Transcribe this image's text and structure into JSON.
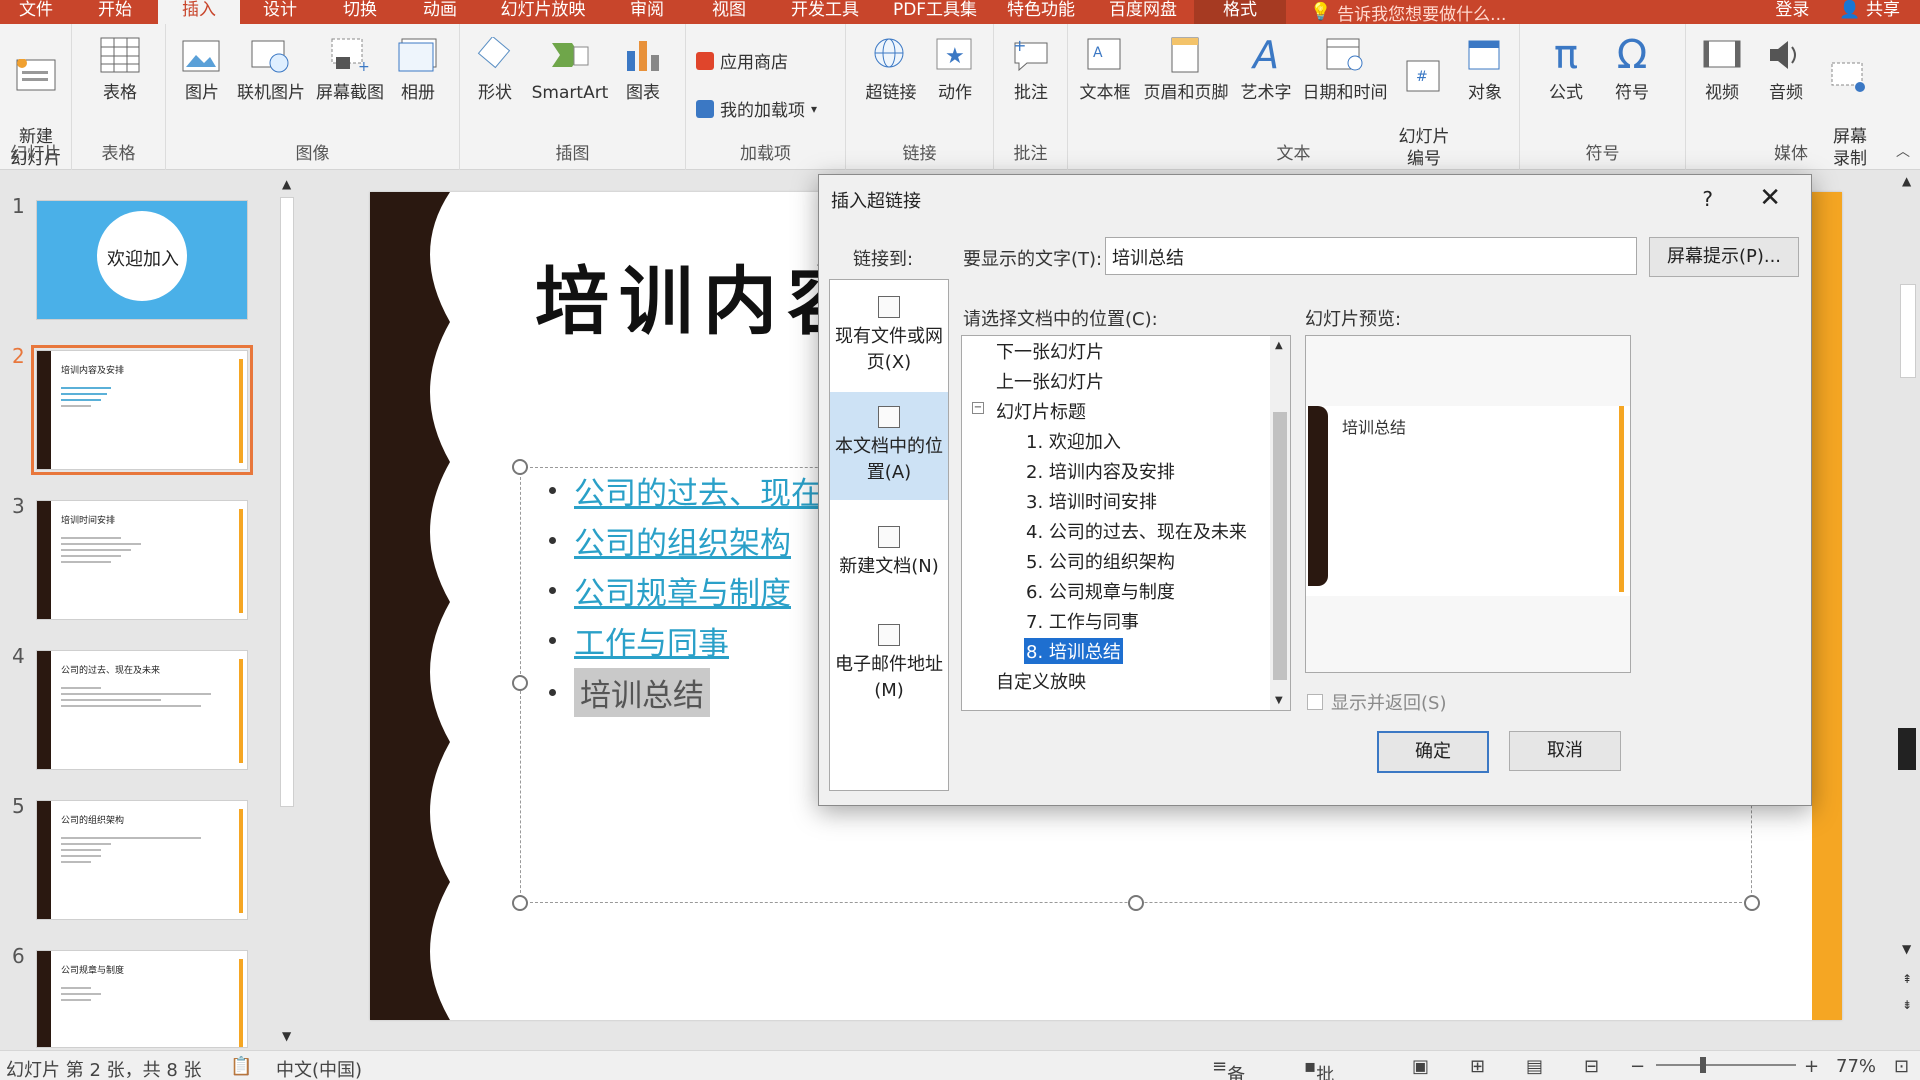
{
  "tabs": [
    "文件",
    "开始",
    "插入",
    "设计",
    "切换",
    "动画",
    "幻灯片放映",
    "审阅",
    "视图",
    "开发工具",
    "PDF工具集",
    "特色功能",
    "百度网盘",
    "格式"
  ],
  "active_tab": "插入",
  "tellme": "告诉我您想要做什么...",
  "login": "登录",
  "share": "共享",
  "ribbon": {
    "new_slide": "新建\n幻灯片",
    "table": "表格",
    "picture": "图片",
    "online_picture": "联机图片",
    "screenshot": "屏幕截图",
    "album": "相册",
    "shapes": "形状",
    "smartart": "SmartArt",
    "chart": "图表",
    "store": "应用商店",
    "my_addins": "我的加载项",
    "hyperlink": "超链接",
    "action": "动作",
    "comment": "批注",
    "textbox": "文本框",
    "header_footer": "页眉和页脚",
    "wordart": "艺术字",
    "datetime": "日期和时间",
    "slide_number": "幻灯片\n编号",
    "object": "对象",
    "equation": "公式",
    "symbol": "符号",
    "video": "视频",
    "audio": "音频",
    "screen_record": "屏幕\n录制",
    "groups": {
      "slides": "幻灯片",
      "tables": "表格",
      "images": "图像",
      "illustrations": "插图",
      "addins": "加载项",
      "links": "链接",
      "comments": "批注",
      "text": "文本",
      "symbols": "符号",
      "media": "媒体"
    }
  },
  "thumbnails": [
    {
      "num": "1",
      "title": "欢迎加入"
    },
    {
      "num": "2",
      "title": "培训内容及安排"
    },
    {
      "num": "3",
      "title": "培训时间安排"
    },
    {
      "num": "4",
      "title": "公司的过去、现在及未来"
    },
    {
      "num": "5",
      "title": "公司的组织架构"
    },
    {
      "num": "6",
      "title": "公司规章与制度"
    }
  ],
  "slide": {
    "title": "培训内容",
    "bullets": [
      "公司的过去、现在及",
      "公司的组织架构",
      "公司规章与制度",
      "工作与同事",
      "培训总结"
    ]
  },
  "dialog": {
    "title": "插入超链接",
    "help": "?",
    "close": "✕",
    "link_to": "链接到:",
    "display_text_label": "要显示的文字(T):",
    "display_text_value": "培训总结",
    "screentip": "屏幕提示(P)...",
    "sidebar": [
      "现有文件或网页(X)",
      "本文档中的位置(A)",
      "新建文档(N)",
      "电子邮件地址(M)"
    ],
    "select_label": "请选择文档中的位置(C):",
    "preview_label": "幻灯片预览:",
    "tree": [
      "下一张幻灯片",
      "上一张幻灯片",
      "幻灯片标题",
      "1. 欢迎加入",
      "2. 培训内容及安排",
      "3. 培训时间安排",
      "4. 公司的过去、现在及未来",
      "5. 公司的组织架构",
      "6. 公司规章与制度",
      "7. 工作与同事",
      "8. 培训总结",
      "自定义放映"
    ],
    "preview_title": "培训总结",
    "show_return": "显示并返回(S)",
    "ok": "确定",
    "cancel": "取消"
  },
  "status": {
    "slide_info": "幻灯片 第 2 张，共 8 张",
    "lang": "中文(中国)",
    "notes": "备注",
    "comments": "批注",
    "zoom": "77%"
  },
  "colors": {
    "accent": "#c8452b",
    "link": "#2aa0c8",
    "selection": "#1e6fd0",
    "orange": "#f5a623"
  }
}
